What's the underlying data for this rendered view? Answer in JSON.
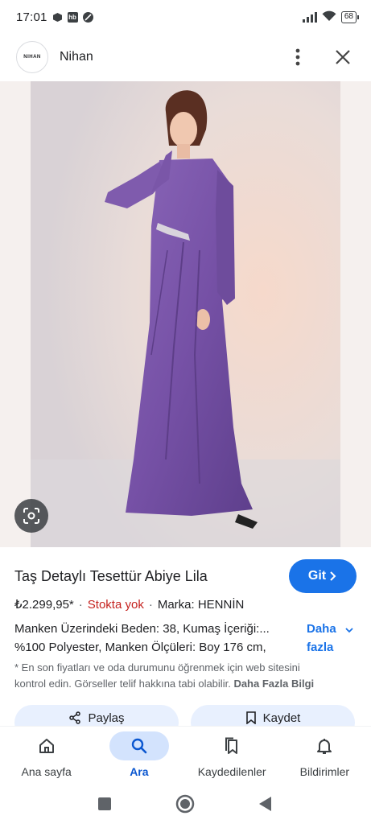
{
  "status_bar": {
    "time": "17:01",
    "battery": "68"
  },
  "header": {
    "logo_text": "NIHAN",
    "site_name": "Nihan"
  },
  "product": {
    "title": "Taş Detaylı Tesettür Abiye Lila",
    "visit_button": "Git",
    "price": "₺2.299,95*",
    "stock_status": "Stokta yok",
    "brand": "Marka: HENNİN",
    "description_line1": "Manken Üzerindeki Beden: 38, Kumaş İçeriği:...",
    "description_line2": "%100 Polyester, Manken Ölçüleri: Boy 176 cm,",
    "more_label_1": "Daha",
    "more_label_2": "fazla",
    "disclaimer_line1": "* En son fiyatları ve oda durumunu öğrenmek için web sitesini",
    "disclaimer_line2": "kontrol edin. Görseller telif hakkına tabi olabilir.",
    "disclaimer_link": "Daha Fazla Bilgi"
  },
  "actions": {
    "share": "Paylaş",
    "save": "Kaydet"
  },
  "bottom_nav": {
    "items": [
      {
        "label": "Ana sayfa",
        "icon": "home-icon"
      },
      {
        "label": "Ara",
        "icon": "search-icon",
        "active": true
      },
      {
        "label": "Kaydedilenler",
        "icon": "bookmarks-icon"
      },
      {
        "label": "Bildirimler",
        "icon": "bell-icon"
      }
    ]
  },
  "colors": {
    "accent": "#1a73e8",
    "stock_out": "#c5221f",
    "dress": "#7c5aa6"
  }
}
